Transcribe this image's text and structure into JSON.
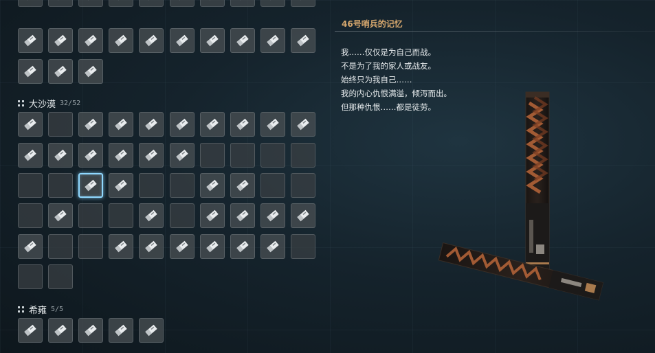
{
  "sections": [
    {
      "name": "",
      "count": ""
    },
    {
      "name": "大沙漠",
      "count": "32/52"
    },
    {
      "name": "希雍",
      "count": "5/5"
    }
  ],
  "detail": {
    "title": "46号哨兵的记忆",
    "lore": [
      "我……仅仅是为自己而战。",
      "不是为了我的家人或战友。",
      "始终只为我自己……",
      "我的内心仇恨满溢，倾泻而出。",
      "但那种仇恨……都是徒劳。"
    ]
  },
  "colors": {
    "accent_title": "#d7a86e",
    "selected_border": "#8fd8ff",
    "tile_bg": "#484e52"
  },
  "icons": {
    "tile_icon": "memory-shard-icon",
    "header_icon": "grid-dots-icon"
  }
}
